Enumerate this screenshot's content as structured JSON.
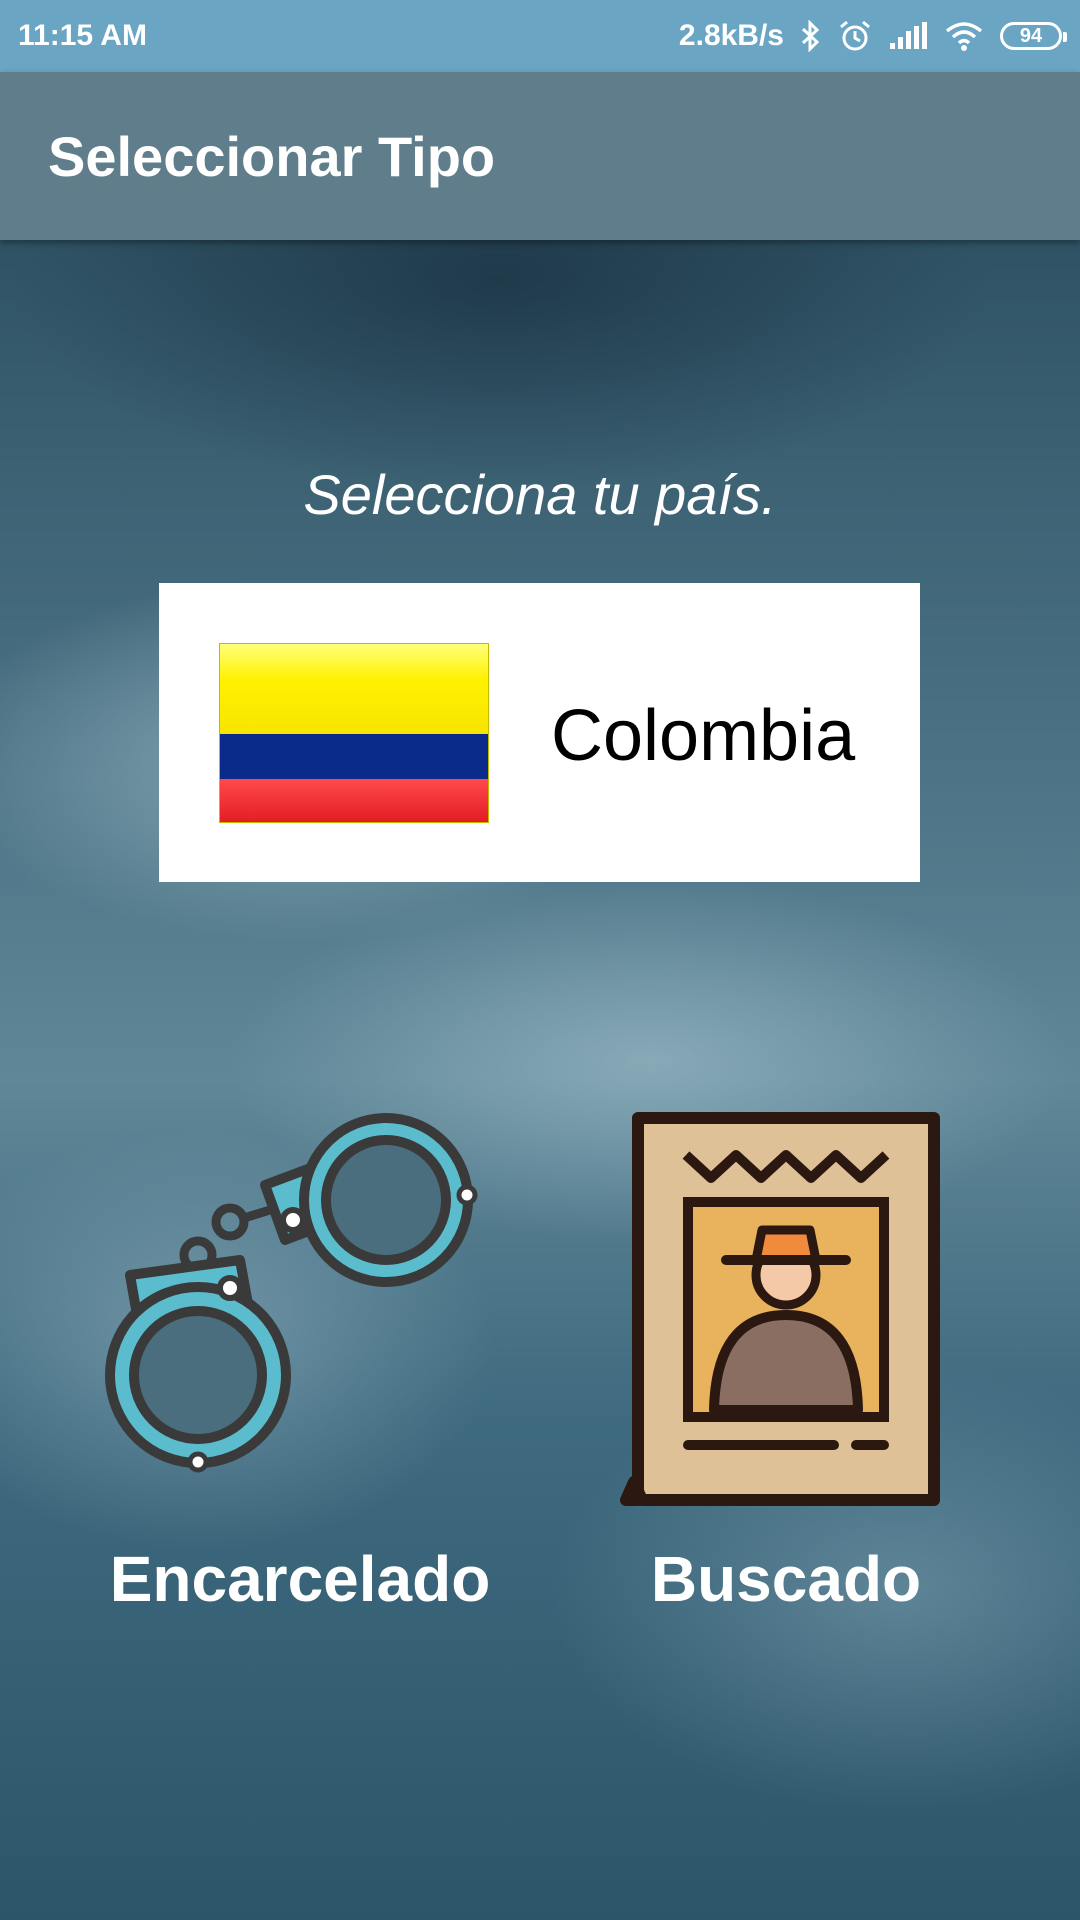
{
  "status_bar": {
    "time": "11:15 AM",
    "net_speed": "2.8kB/s",
    "battery": "94",
    "icons": [
      "bluetooth-icon",
      "alarm-icon",
      "signal-icon",
      "wifi-icon",
      "battery-icon"
    ]
  },
  "app_bar": {
    "title": "Seleccionar Tipo"
  },
  "main": {
    "prompt": "Selecciona tu país.",
    "country": {
      "name": "Colombia",
      "flag_icon": "colombia-flag-icon",
      "flag_colors": [
        "#fff200",
        "#0b2b8a",
        "#e21b22"
      ]
    },
    "options": [
      {
        "label": "Encarcelado",
        "icon": "handcuffs-icon"
      },
      {
        "label": "Buscado",
        "icon": "wanted-poster-icon"
      }
    ]
  },
  "colors": {
    "status_bar": "#6aa5c3",
    "app_bar": "#607d8b",
    "handcuffs": "#5bbccd",
    "poster": "#dfc197"
  }
}
